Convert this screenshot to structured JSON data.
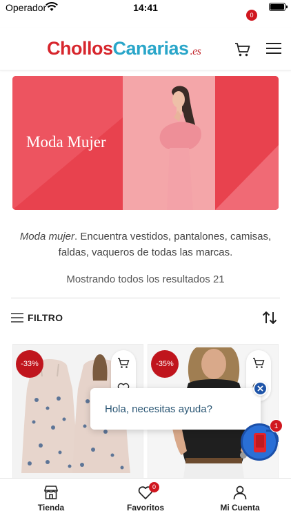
{
  "status_bar": {
    "carrier": "Operador",
    "time": "14:41"
  },
  "header": {
    "logo": {
      "part1": "Chollos",
      "part2": "Canarias",
      "part3": ".es"
    },
    "cart_count": "0",
    "icons": {
      "cart": "cart-icon",
      "menu": "menu-icon"
    }
  },
  "banner": {
    "title": "Moda Mujer",
    "colors": {
      "main": "#e8424e",
      "panel": "#f4a6a9"
    }
  },
  "category": {
    "name": "Moda mujer",
    "description": ". Encuentra vestidos, pantalones, camisas, faldas, vaqueros de todas las marcas.",
    "results_text": "Mostrando todos los resultados 21"
  },
  "toolbar": {
    "filter_label": "FILTRO",
    "icons": {
      "filter": "filter-icon",
      "sort": "sort-icon"
    }
  },
  "products": [
    {
      "discount": "-33%"
    },
    {
      "discount": "-35%"
    }
  ],
  "chat": {
    "message": "Hola, necesitas ayuda?",
    "unread": "1"
  },
  "bottom_nav": {
    "items": [
      {
        "label": "Tienda",
        "icon": "store-icon"
      },
      {
        "label": "Favoritos",
        "icon": "heart-icon",
        "badge": "0"
      },
      {
        "label": "Mi Cuenta",
        "icon": "user-icon"
      }
    ]
  },
  "colors": {
    "brand_red": "#d7262d",
    "brand_blue": "#2aa6c9",
    "badge_red": "#d0171f",
    "chat_blue": "#2a6fd6"
  }
}
